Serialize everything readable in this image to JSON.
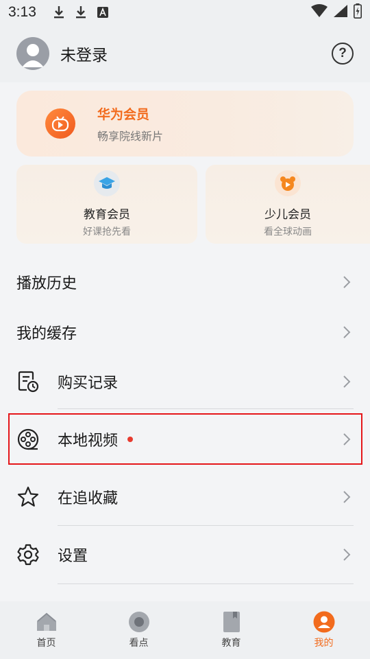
{
  "status_bar": {
    "time": "3:13"
  },
  "header": {
    "username": "未登录",
    "help_symbol": "?"
  },
  "vip": {
    "title": "华为会员",
    "subtitle": "畅享院线新片"
  },
  "sub_vips": [
    {
      "title": "教育会员",
      "subtitle": "好课抢先看"
    },
    {
      "title": "少儿会员",
      "subtitle": "看全球动画"
    }
  ],
  "menu": {
    "history": "播放历史",
    "cache": "我的缓存",
    "purchase": "购买记录",
    "local_video": "本地视频",
    "favorites": "在追收藏",
    "settings": "设置"
  },
  "bottom_nav": [
    {
      "label": "首页",
      "active": false
    },
    {
      "label": "看点",
      "active": false
    },
    {
      "label": "教育",
      "active": false
    },
    {
      "label": "我的",
      "active": true
    }
  ],
  "colors": {
    "accent": "#f26b1d",
    "highlight_border": "#e5161a",
    "red_dot": "#e73b2f"
  }
}
